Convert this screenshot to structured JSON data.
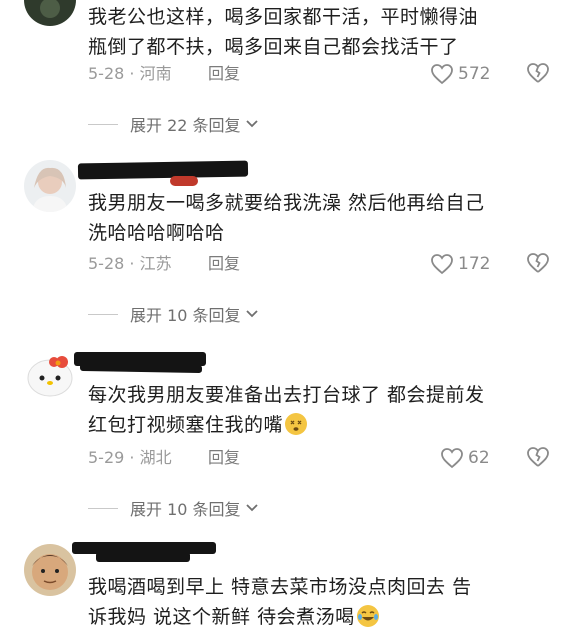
{
  "comments": [
    {
      "text_line1": "我老公也这样，喝多回家都干活，平时懒得油",
      "text_line2": "瓶倒了都不扶，喝多回来自己都会找活干了",
      "date": "5-28",
      "location": "河南",
      "reply_label": "回复",
      "likes": "572",
      "expand_label": "展开 22 条回复"
    },
    {
      "text_line1": "我男朋友一喝多就要给我洗澡 然后他再给自己",
      "text_line2": "洗哈哈哈啊哈哈",
      "date": "5-28",
      "location": "江苏",
      "reply_label": "回复",
      "likes": "172",
      "expand_label": "展开 10 条回复"
    },
    {
      "text_line1": "每次我男朋友要准备出去打台球了 都会提前发",
      "text_line2": "红包打视频塞住我的嘴",
      "date": "5-29",
      "location": "湖北",
      "reply_label": "回复",
      "likes": "62",
      "expand_label": "展开 10 条回复"
    },
    {
      "text_line1": "我喝酒喝到早上  特意去菜市场没点肉回去  告",
      "text_line2": "诉我妈  说这个新鲜  待会煮汤喝"
    }
  ],
  "icons": {
    "like": "heart-outline-icon",
    "dislike": "broken-heart-icon",
    "expand": "chevron-down-icon"
  },
  "colors": {
    "text": "#1e1e1e",
    "meta": "#9a9a9a",
    "redaction": "#141414"
  }
}
